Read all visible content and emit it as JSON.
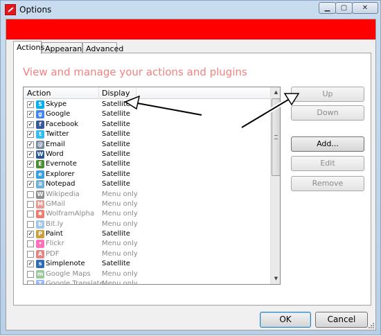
{
  "window": {
    "title": "Options",
    "controls": {
      "minimize": "▁",
      "maximize": "▢",
      "close": "✕"
    }
  },
  "colors": {
    "banner": "#ff0000",
    "heading": "#f48080"
  },
  "tabs": [
    {
      "label": "Actions",
      "active": true
    },
    {
      "label": "Appearance",
      "active": false
    },
    {
      "label": "Advanced",
      "active": false
    }
  ],
  "heading": "View and manage your actions and plugins",
  "list": {
    "columns": {
      "action": "Action",
      "display": "Display"
    },
    "rows": [
      {
        "name": "Skype",
        "display": "Satellite",
        "checked": true,
        "icon": "skype-icon",
        "color": "#00aff0",
        "glyph": "S"
      },
      {
        "name": "Google",
        "display": "Satellite",
        "checked": true,
        "icon": "google-icon",
        "color": "#4285f4",
        "glyph": "g"
      },
      {
        "name": "Facebook",
        "display": "Satellite",
        "checked": true,
        "icon": "facebook-icon",
        "color": "#3b5998",
        "glyph": "f"
      },
      {
        "name": "Twitter",
        "display": "Satellite",
        "checked": true,
        "icon": "twitter-icon",
        "color": "#33bdf0",
        "glyph": "t"
      },
      {
        "name": "Email",
        "display": "Satellite",
        "checked": true,
        "icon": "email-icon",
        "color": "#7a8a9e",
        "glyph": "@"
      },
      {
        "name": "Word",
        "display": "Satellite",
        "checked": true,
        "icon": "word-icon",
        "color": "#2b5797",
        "glyph": "W"
      },
      {
        "name": "Evernote",
        "display": "Satellite",
        "checked": true,
        "icon": "evernote-icon",
        "color": "#4a8f2f",
        "glyph": "E"
      },
      {
        "name": "Explorer",
        "display": "Satellite",
        "checked": true,
        "icon": "explorer-icon",
        "color": "#3aa0de",
        "glyph": "e"
      },
      {
        "name": "Notepad",
        "display": "Satellite",
        "checked": true,
        "icon": "notepad-icon",
        "color": "#6fb0d8",
        "glyph": "≡"
      },
      {
        "name": "Wikipedia",
        "display": "Menu only",
        "checked": false,
        "icon": "wikipedia-icon",
        "color": "#333333",
        "glyph": "W"
      },
      {
        "name": "GMail",
        "display": "Menu only",
        "checked": false,
        "icon": "gmail-icon",
        "color": "#d44638",
        "glyph": "M"
      },
      {
        "name": "WolframAlpha",
        "display": "Menu only",
        "checked": false,
        "icon": "wolframalpha-icon",
        "color": "#dd1100",
        "glyph": "✱"
      },
      {
        "name": "Bit.ly",
        "display": "Menu only",
        "checked": false,
        "icon": "bitly-icon",
        "color": "#5a9bd5",
        "glyph": "b"
      },
      {
        "name": "Paint",
        "display": "Satellite",
        "checked": true,
        "icon": "paint-icon",
        "color": "#c8a040",
        "glyph": "P"
      },
      {
        "name": "Flickr",
        "display": "Menu only",
        "checked": false,
        "icon": "flickr-icon",
        "color": "#ff0084",
        "glyph": "•"
      },
      {
        "name": "PDF",
        "display": "Menu only",
        "checked": false,
        "icon": "pdf-icon",
        "color": "#d02020",
        "glyph": "A"
      },
      {
        "name": "Simplenote",
        "display": "Satellite",
        "checked": true,
        "icon": "simplenote-icon",
        "color": "#2e6db4",
        "glyph": "s"
      },
      {
        "name": "Google Maps",
        "display": "Menu only",
        "checked": false,
        "icon": "google-maps-icon",
        "color": "#4a9c4a",
        "glyph": "m"
      },
      {
        "name": "Google Translate",
        "display": "Menu only",
        "checked": false,
        "icon": "google-translate-icon",
        "color": "#4285f4",
        "glyph": "T"
      }
    ]
  },
  "side_buttons": {
    "up": "Up",
    "down": "Down",
    "add": "Add...",
    "edit": "Edit",
    "remove": "Remove"
  },
  "footer": {
    "ok": "OK",
    "cancel": "Cancel"
  }
}
